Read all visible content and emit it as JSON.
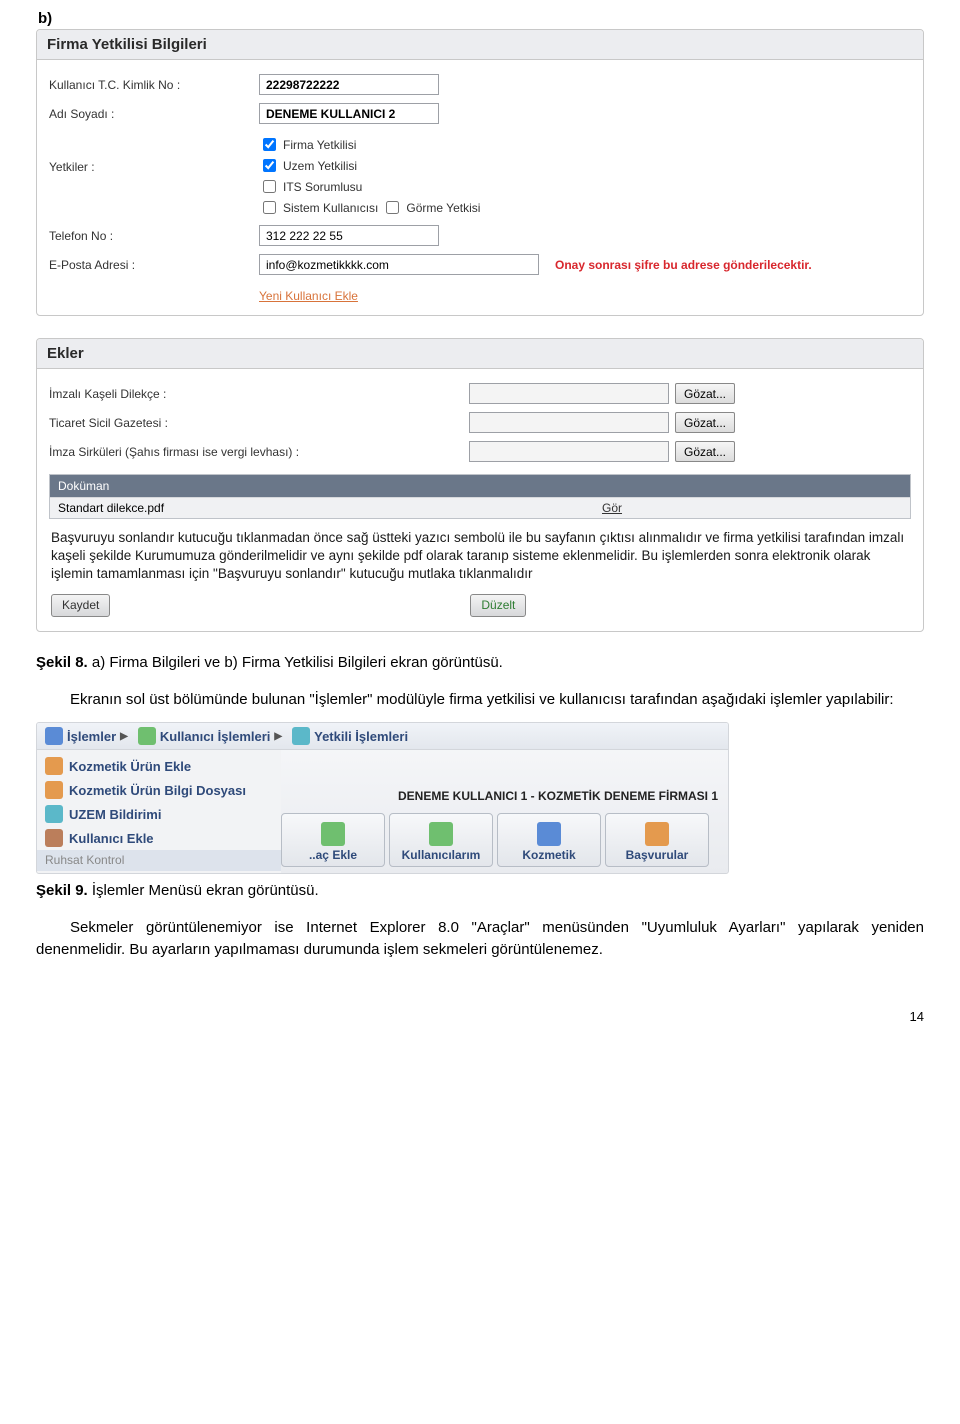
{
  "header_b": "b)",
  "panel1": {
    "title": "Firma Yetkilisi Bilgileri",
    "labels": {
      "tc": "Kullanıcı T.C. Kimlik No :",
      "ad": "Adı Soyadı :",
      "yetkiler": "Yetkiler :",
      "tel": "Telefon No :",
      "email": "E-Posta Adresi :"
    },
    "values": {
      "tc": "22298722222",
      "ad": "DENEME KULLANICI 2",
      "tel": "312 222 22 55",
      "email": "info@kozmetikkkk.com"
    },
    "checks": {
      "firma": "Firma Yetkilisi",
      "uzem": "Uzem Yetkilisi",
      "its": "ITS Sorumlusu",
      "sistem": "Sistem Kullanıcısı",
      "gorme": "Görme Yetkisi"
    },
    "email_warning": "Onay sonrası şifre bu adrese gönderilecektir.",
    "add_link": "Yeni Kullanıcı Ekle"
  },
  "panel2": {
    "title": "Ekler",
    "labels": {
      "dilekce": "İmzalı Kaşeli Dilekçe :",
      "gazete": "Ticaret Sicil Gazetesi :",
      "sirkuler": "İmza Sirküleri (Şahıs firması ise vergi levhası) :"
    },
    "browse": "Gözat...",
    "doc_header": "Doküman",
    "doc_name": "Standart dilekce.pdf",
    "doc_action": "Gör",
    "info": "Başvuruyu sonlandır kutucuğu tıklanmadan önce sağ üstteki yazıcı sembolü ile bu sayfanın çıktısı alınmalıdır ve firma yetkilisi tarafından imzalı kaşeli şekilde Kurumumuza gönderilmelidir ve aynı şekilde pdf olarak taranıp sisteme eklenmelidir. Bu işlemlerden sonra elektronik olarak işlemin tamamlanması için \"Başvuruyu sonlandır\" kutucuğu mutlaka tıklanmalıdır",
    "save": "Kaydet",
    "edit": "Düzelt"
  },
  "caption8": {
    "bold": "Şekil 8.",
    "rest": " a) Firma Bilgileri ve b) Firma Yetkilisi Bilgileri ekran görüntüsü."
  },
  "para1": "Ekranın sol üst bölümünde bulunan \"İşlemler\" modülüyle firma yetkilisi ve kullanıcısı tarafından aşağıdaki işlemler yapılabilir:",
  "menu": {
    "top1": "İşlemler",
    "top2": "Kullanıcı İşlemleri",
    "top3": "Yetkili İşlemleri",
    "left": {
      "l1": "Kozmetik Ürün Ekle",
      "l2": "Kozmetik Ürün Bilgi Dosyası",
      "l3": "UZEM Bildirimi",
      "l4": "Kullanıcı Ekle",
      "l5": "Ruhsat Kontrol"
    },
    "user_line": "DENEME KULLANICI 1 - KOZMETİK DENEME FİRMASI 1",
    "btns": {
      "b0": "..aç Ekle",
      "b1": "Kullanıcılarım",
      "b2": "Kozmetik",
      "b3": "Başvurular"
    }
  },
  "caption9": {
    "bold": "Şekil 9.",
    "rest": " İşlemler Menüsü ekran görüntüsü."
  },
  "para2": "Sekmeler görüntülenemiyor ise Internet Explorer 8.0 \"Araçlar\" menüsünden \"Uyumluluk Ayarları\" yapılarak yeniden denenmelidir. Bu ayarların yapılmaması durumunda işlem sekmeleri görüntülenemez.",
  "page_num": "14"
}
